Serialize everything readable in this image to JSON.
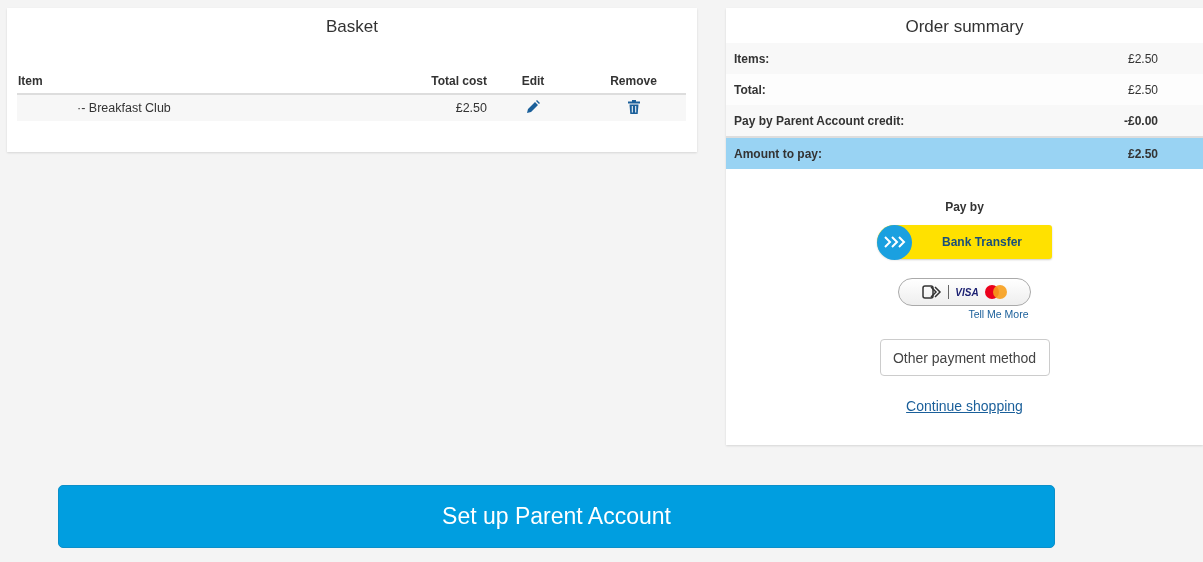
{
  "basket": {
    "title": "Basket",
    "columns": [
      "Item",
      "Total cost",
      "Edit",
      "Remove"
    ],
    "rows": [
      {
        "item": "·- Breakfast Club",
        "total_cost": "£2.50"
      }
    ]
  },
  "order_summary": {
    "title": "Order summary",
    "rows": [
      {
        "label": "Items:",
        "value": "£2.50",
        "highlighted": false,
        "bold_value": false
      },
      {
        "label": "Total:",
        "value": "£2.50",
        "highlighted": false,
        "bold_value": false
      },
      {
        "label": "Pay by Parent Account credit:",
        "value": "-£0.00",
        "highlighted": false,
        "bold_value": true
      },
      {
        "label": "Amount to pay:",
        "value": "£2.50",
        "highlighted": true,
        "bold_value": true
      }
    ],
    "pay_by_label": "Pay by",
    "bank_transfer_button": "Bank Transfer",
    "card_button_visa": "VISA",
    "tell_me_more_link": "Tell Me More",
    "other_payment_button": "Other payment method",
    "continue_link": "Continue shopping"
  },
  "setup_button": "Set up Parent Account"
}
